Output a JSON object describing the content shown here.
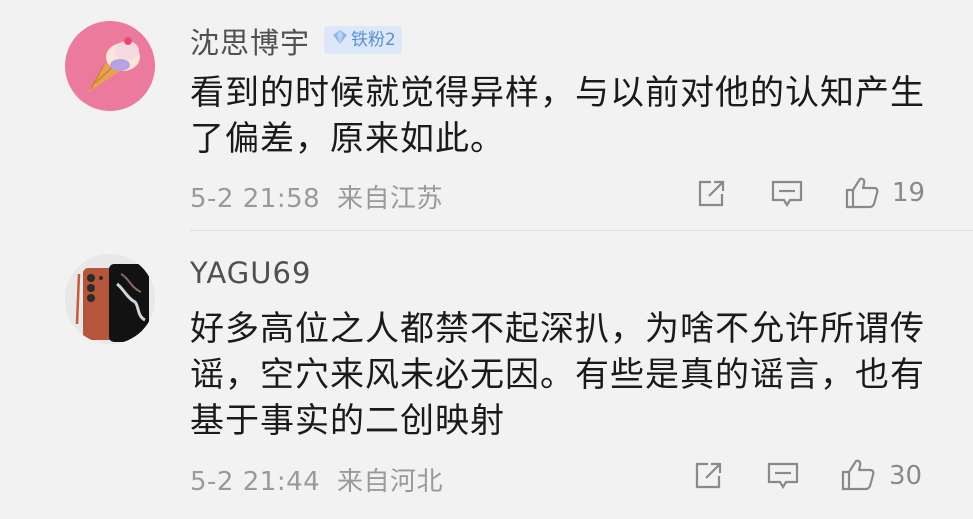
{
  "comments": [
    {
      "username": "沈思博宇",
      "badge": "铁粉2",
      "content": "看到的时候就觉得异样，与以前对他的认知产生了偏差，原来如此。",
      "time": "5-2 21:58",
      "location": "来自江苏",
      "likes": "19",
      "avatar_icon": "ice-cream-icon"
    },
    {
      "username": "YAGU69",
      "badge": "",
      "content": "好多高位之人都禁不起深扒，为啥不允许所谓传谣，空穴来风未必无因。有些是真的谣言，也有基于事实的二创映射",
      "time": "5-2 21:44",
      "location": "来自河北",
      "likes": "30",
      "avatar_icon": "phone-icon"
    }
  ],
  "colors": {
    "background": "#f2f2f2",
    "badge_bg": "#dce8f7",
    "badge_text": "#5b8fd0",
    "meta_text": "#9a9a9a"
  }
}
